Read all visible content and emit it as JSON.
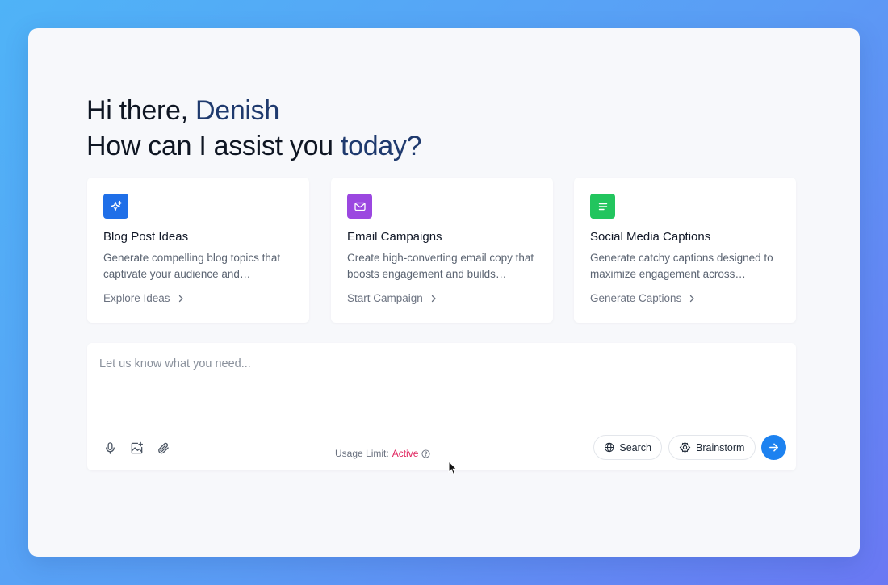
{
  "greeting": {
    "line1_prefix": "Hi there, ",
    "name": "Denish",
    "line2_prefix": "How can I assist you ",
    "line2_accent": "today?"
  },
  "cards": [
    {
      "icon": "sparkles-icon",
      "color": "#1f6fe8",
      "title": "Blog Post Ideas",
      "description": "Generate compelling blog topics that captivate your audience and…",
      "link": "Explore Ideas"
    },
    {
      "icon": "mail-icon",
      "color": "#9b47e0",
      "title": "Email Campaigns",
      "description": "Create high-converting email copy that boosts engagement and builds…",
      "link": "Start Campaign"
    },
    {
      "icon": "text-lines-icon",
      "color": "#22c55e",
      "title": "Social Media Captions",
      "description": "Generate catchy captions designed to maximize engagement across…",
      "link": "Generate Captions"
    }
  ],
  "composer": {
    "placeholder": "Let us know what you need...",
    "value": "",
    "usage_label": "Usage Limit:",
    "usage_status": "Active",
    "search_label": "Search",
    "brainstorm_label": "Brainstorm"
  },
  "colors": {
    "accent_text": "#1f3a6e",
    "send_button": "#1d82f0",
    "usage_status": "#e0245e"
  }
}
